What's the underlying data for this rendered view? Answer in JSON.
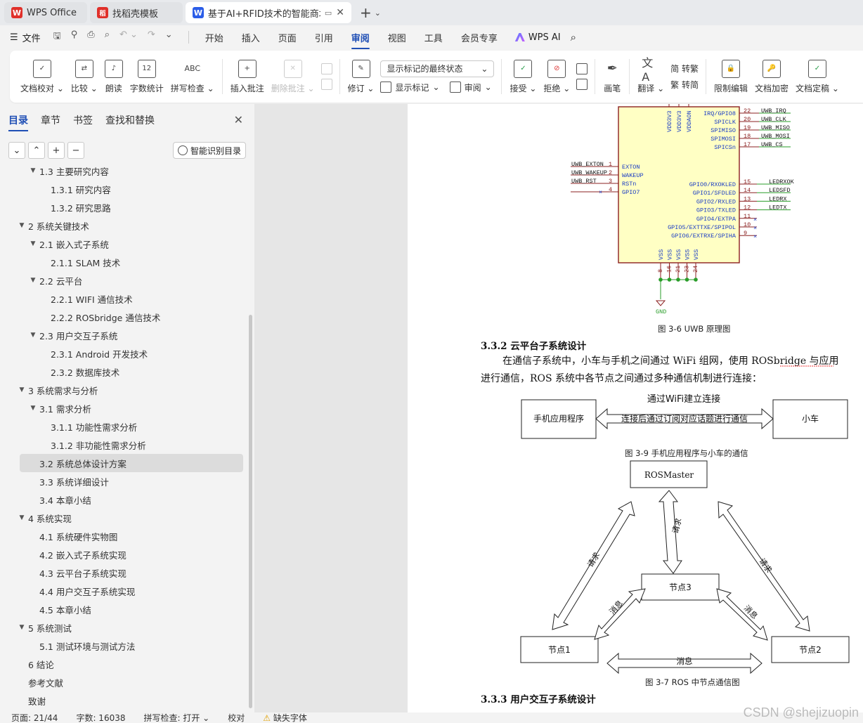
{
  "tabs": [
    {
      "title": "WPS Office",
      "logo": "W",
      "color": "#e0302a"
    },
    {
      "title": "找稻壳模板",
      "logo": "稻",
      "color": "#e0302a"
    },
    {
      "title": "基于AI+RFID技术的智能商场",
      "logo": "W",
      "color": "#2b5de8"
    }
  ],
  "menu": {
    "file_label": "文件",
    "items": [
      "开始",
      "插入",
      "页面",
      "引用",
      "审阅",
      "视图",
      "工具",
      "会员专享"
    ],
    "active": "审阅",
    "ai_label": "WPS AI"
  },
  "ribbon": {
    "doc_check": "文档校对",
    "compare": "比较",
    "read_aloud": "朗读",
    "word_count": "字数统计",
    "spell_check": "拼写检查",
    "insert_comment": "插入批注",
    "delete_comment": "删除批注",
    "track": "修订",
    "markup_dropdown": "显示标记的最终状态",
    "show_markup": "显示标记",
    "review": "审阅",
    "accept": "接受",
    "reject": "拒绝",
    "pen": "画笔",
    "translate": "翻译",
    "to_traditional": "简 转繁",
    "to_simplified": "繁 转简",
    "restrict_edit": "限制编辑",
    "encrypt": "文档加密",
    "finalize": "文档定稿"
  },
  "sidebar": {
    "tabs": [
      "目录",
      "章节",
      "书签",
      "查找和替换"
    ],
    "smart_btn": "智能识别目录",
    "toc": [
      {
        "text": "1.3 主要研究内容",
        "level": 2,
        "caret": "down"
      },
      {
        "text": "1.3.1 研究内容",
        "level": 3
      },
      {
        "text": "1.3.2 研究思路",
        "level": 3
      },
      {
        "text": "2  系统关键技术",
        "level": 1,
        "caret": "down"
      },
      {
        "text": "2.1 嵌入式子系统",
        "level": 2,
        "caret": "down"
      },
      {
        "text": "2.1.1 SLAM 技术",
        "level": 3
      },
      {
        "text": "2.2 云平台",
        "level": 2,
        "caret": "down"
      },
      {
        "text": "2.2.1 WIFI 通信技术",
        "level": 3
      },
      {
        "text": "2.2.2 ROSbridge 通信技术",
        "level": 3
      },
      {
        "text": "2.3 用户交互子系统",
        "level": 2,
        "caret": "down"
      },
      {
        "text": "2.3.1 Android 开发技术",
        "level": 3
      },
      {
        "text": "2.3.2  数据库技术",
        "level": 3
      },
      {
        "text": "3 系统需求与分析",
        "level": 1,
        "caret": "down"
      },
      {
        "text": "3.1 需求分析",
        "level": 2,
        "caret": "down"
      },
      {
        "text": "3.1.1  功能性需求分析",
        "level": 3
      },
      {
        "text": "3.1.2  非功能性需求分析",
        "level": 3
      },
      {
        "text": "3.2 系统总体设计方案",
        "level": 2,
        "selected": true
      },
      {
        "text": "3.3 系统详细设计",
        "level": 2
      },
      {
        "text": "3.4 本章小结",
        "level": 2
      },
      {
        "text": "4  系统实现",
        "level": 1,
        "caret": "down"
      },
      {
        "text": "4.1 系统硬件实物图",
        "level": 2
      },
      {
        "text": "4.2 嵌入式子系统实现",
        "level": 2
      },
      {
        "text": "4.3 云平台子系统实现",
        "level": 2
      },
      {
        "text": "4.4  用户交互子系统实现",
        "level": 2
      },
      {
        "text": "4.5  本章小结",
        "level": 2
      },
      {
        "text": "5  系统测试",
        "level": 1,
        "caret": "down"
      },
      {
        "text": "5.1  测试环境与测试方法",
        "level": 2
      },
      {
        "text": "6  结论",
        "level": 1
      },
      {
        "text": "参考文献",
        "level": 1
      },
      {
        "text": "致谢",
        "level": 1
      }
    ]
  },
  "document": {
    "uwb": {
      "pins_top": [
        "VDD3V3",
        "VDD3V3",
        "VDDAON"
      ],
      "right_pins": [
        {
          "name": "IRQ/GPIO8",
          "num": "22",
          "net": "UWB_IRQ"
        },
        {
          "name": "SPICLK",
          "num": "20",
          "net": "UWB_CLK"
        },
        {
          "name": "SPIMISO",
          "num": "19",
          "net": "UWB_MISO"
        },
        {
          "name": "SPIMOSI",
          "num": "18",
          "net": "UWB_MOSI"
        },
        {
          "name": "SPICSn",
          "num": "17",
          "net": "UWB_CS"
        }
      ],
      "left_pins": [
        {
          "name": "EXTON",
          "num": "1",
          "net": "UWB_EXTON"
        },
        {
          "name": "WAKEUP",
          "num": "2",
          "net": "UWB_WAKEUP"
        },
        {
          "name": "RSTn",
          "num": "3",
          "net": "UWB_RST"
        },
        {
          "name": "GPIO7",
          "num": "4",
          "net": ""
        }
      ],
      "gpio_pins": [
        {
          "name": "GPIO0/RXOKLED",
          "num": "15",
          "net": "LEDRXOK"
        },
        {
          "name": "GPIO1/SFDLED",
          "num": "14",
          "net": "LEDSFD"
        },
        {
          "name": "GPIO2/RXLED",
          "num": "13",
          "net": "LEDRX"
        },
        {
          "name": "GPIO3/TXLED",
          "num": "12",
          "net": "LEDTX"
        },
        {
          "name": "GPIO4/EXTPA",
          "num": "11",
          "net": ""
        },
        {
          "name": "GPIO5/EXTTXE/SPIPOL",
          "num": "10",
          "net": ""
        },
        {
          "name": "GPIO6/EXTRXE/SPIHA",
          "num": "9",
          "net": ""
        }
      ],
      "vss_pins": [
        "8",
        "16",
        "21",
        "23",
        "24"
      ],
      "vss_label": "VSS",
      "gnd": "GND"
    },
    "cap_uwb": "图 3-6 UWB 原理图",
    "h332": "3.3.2  云平台子系统设计",
    "para_line1": "在通信子系统中，小车与手机之间通过 WiFi 组网，使用 ROSbridge 与应用",
    "para_line2": "进行通信，ROS 系统中各节点之间通过多种通信机制进行连接：",
    "fig39": {
      "left": "手机应用程序",
      "right": "小车",
      "top": "通过WiFi建立连接",
      "arrow": "连接后通过订阅对应话题进行通信",
      "caption": "图 3-9  手机应用程序与小车的通信"
    },
    "fig37": {
      "master": "ROSMaster",
      "node3": "节点3",
      "node1": "节点1",
      "node2": "节点2",
      "request": "请求",
      "message": "消息",
      "caption": "图 3-7 ROS 中节点通信图"
    },
    "h333": "3.3.3  用户交互子系统设计"
  },
  "status": {
    "page": "页面: 21/44",
    "words": "字数: 16038",
    "spell": "拼写检查: 打开",
    "proof": "校对",
    "missing_font": "缺失字体",
    "watermark": "CSDN @shejizuopin"
  }
}
